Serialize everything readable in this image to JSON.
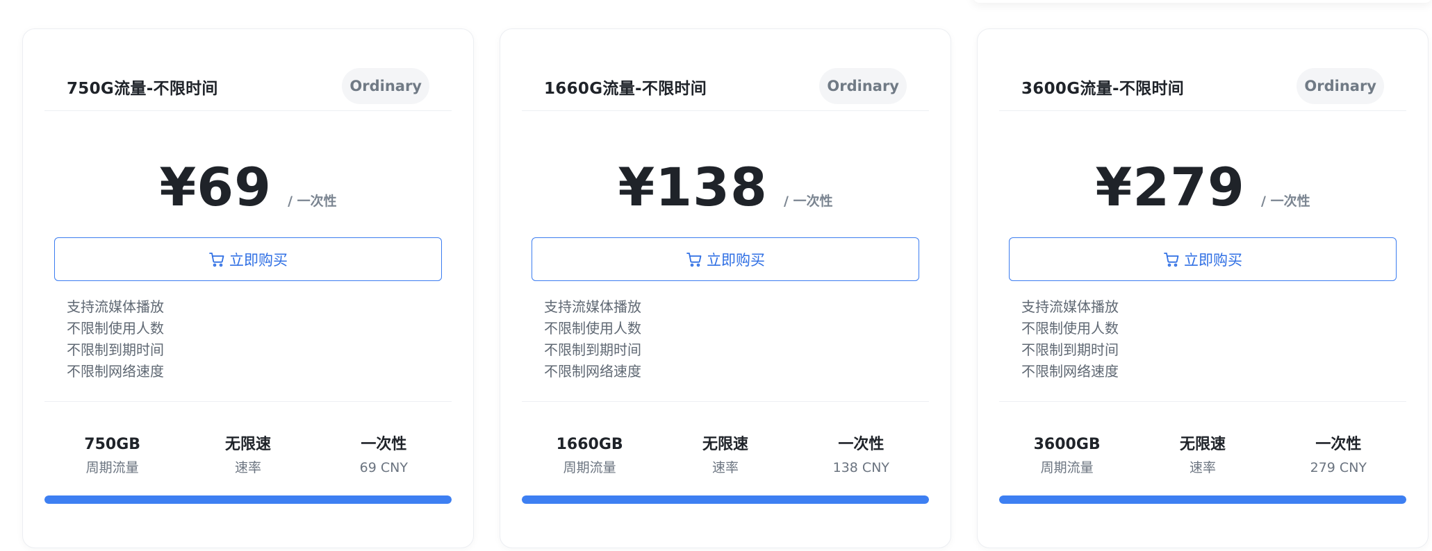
{
  "colors": {
    "accent": "#3d7ff2",
    "button_text": "#2f6fe4",
    "badge_bg": "#f4f5f7",
    "text_primary": "#1f2329",
    "text_secondary": "#6b7480"
  },
  "plans": [
    {
      "name": "750G流量-不限时间",
      "badge": "Ordinary",
      "price": "¥69",
      "period": "/ 一次性",
      "button_label": "立即购买",
      "button_icon": "cart-icon",
      "features": [
        "支持流媒体播放",
        "不限制使用人数",
        "不限制到期时间",
        "不限制网络速度"
      ],
      "stats": [
        {
          "value": "750GB",
          "label": "周期流量"
        },
        {
          "value": "无限速",
          "label": "速率"
        },
        {
          "value": "一次性",
          "label": "69 CNY"
        }
      ],
      "progress": 1.0
    },
    {
      "name": "1660G流量-不限时间",
      "badge": "Ordinary",
      "price": "¥138",
      "period": "/ 一次性",
      "button_label": "立即购买",
      "button_icon": "cart-icon",
      "features": [
        "支持流媒体播放",
        "不限制使用人数",
        "不限制到期时间",
        "不限制网络速度"
      ],
      "stats": [
        {
          "value": "1660GB",
          "label": "周期流量"
        },
        {
          "value": "无限速",
          "label": "速率"
        },
        {
          "value": "一次性",
          "label": "138 CNY"
        }
      ],
      "progress": 1.0
    },
    {
      "name": "3600G流量-不限时间",
      "badge": "Ordinary",
      "price": "¥279",
      "period": "/ 一次性",
      "button_label": "立即购买",
      "button_icon": "cart-icon",
      "features": [
        "支持流媒体播放",
        "不限制使用人数",
        "不限制到期时间",
        "不限制网络速度"
      ],
      "stats": [
        {
          "value": "3600GB",
          "label": "周期流量"
        },
        {
          "value": "无限速",
          "label": "速率"
        },
        {
          "value": "一次性",
          "label": "279 CNY"
        }
      ],
      "progress": 1.0
    }
  ]
}
